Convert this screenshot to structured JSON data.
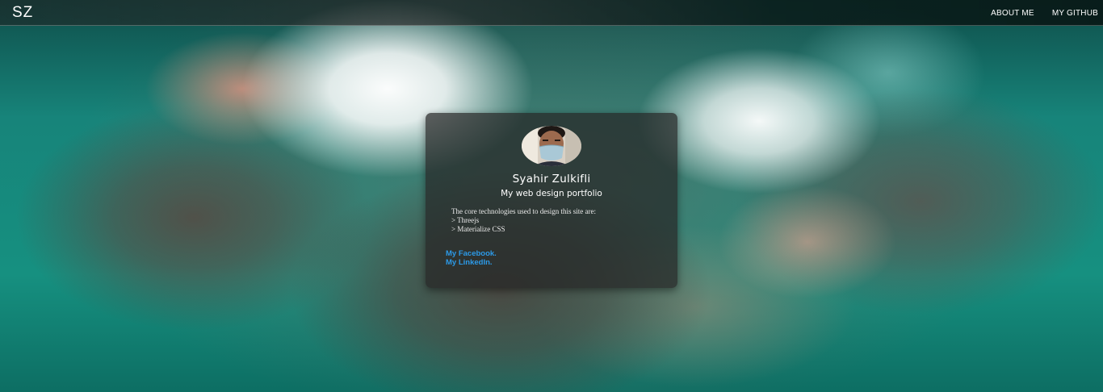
{
  "navbar": {
    "brand": "SZ",
    "links": [
      {
        "label": "ABOUT ME"
      },
      {
        "label": "MY GITHUB"
      }
    ]
  },
  "profile": {
    "name": "Syahir Zulkifli",
    "subtitle": "My web design portfolio",
    "tech_intro": "The core technologies used to design this site are:",
    "tech_items": [
      "> Threejs",
      "> Materialize CSS"
    ],
    "links": [
      {
        "label": "My Facebook."
      },
      {
        "label": "My LinkedIn."
      }
    ]
  },
  "colors": {
    "link": "#2c9ae8",
    "text": "#ffffff",
    "card_bg": "#262626",
    "background": "#17847a"
  }
}
